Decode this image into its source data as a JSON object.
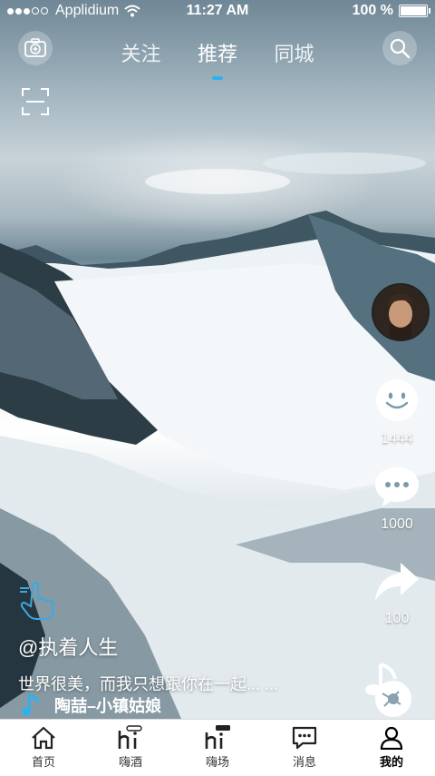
{
  "status_bar": {
    "carrier": "Applidium",
    "time": "11:27 AM",
    "battery": "100 %"
  },
  "top_nav": {
    "tabs": [
      "关注",
      "推荐",
      "同城"
    ],
    "active_tab": "推荐"
  },
  "video": {
    "username": "@执着人生",
    "description": "世界很美，而我只想跟你在一起... ...",
    "music_title": "陶喆–小镇姑娘"
  },
  "side_actions": {
    "likes": "1444",
    "comments": "1000",
    "shares": "100"
  },
  "tab_bar": {
    "items": [
      "首页",
      "嗨酒",
      "嗨场",
      "消息",
      "我的"
    ],
    "active": "我的"
  },
  "colors": {
    "accent": "#2bb3f0",
    "tabbar_bg": "#ffffff"
  }
}
